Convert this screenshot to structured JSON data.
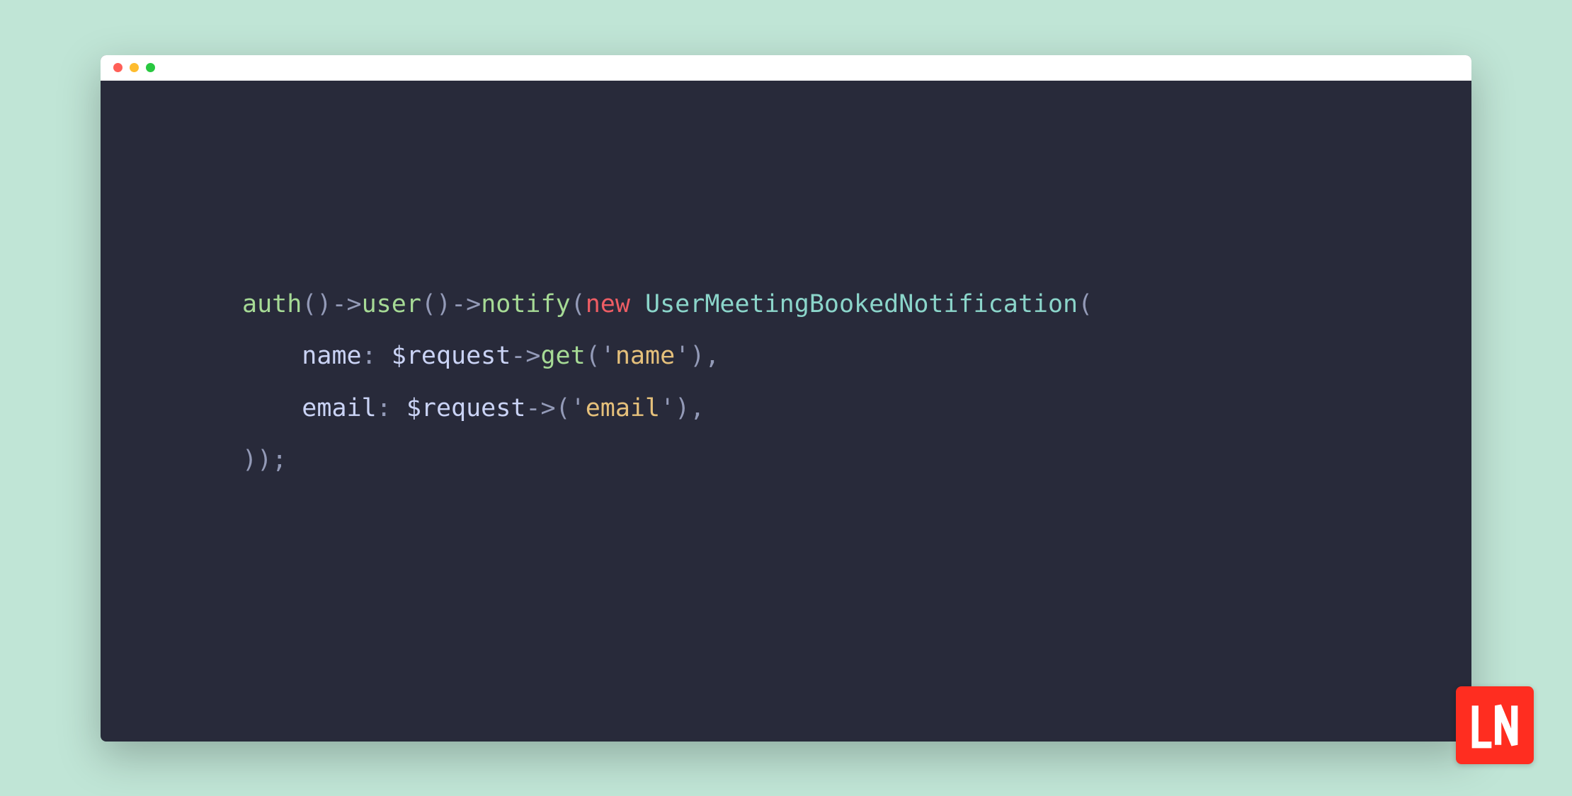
{
  "code": {
    "line1": {
      "auth": "auth",
      "p1": "()",
      "arrow1": "->",
      "user": "user",
      "p2": "()",
      "arrow2": "->",
      "notify": "notify",
      "p3": "(",
      "new": "new",
      "space": " ",
      "class": "UserMeetingBookedNotification",
      "p4": "("
    },
    "line2": {
      "indent": "    ",
      "param": "name",
      "colon": ": ",
      "var": "$request",
      "arrow": "->",
      "method": "get",
      "p1": "(",
      "q1": "'",
      "str": "name",
      "q2": "'",
      "p2": "),"
    },
    "line3": {
      "indent": "    ",
      "param": "email",
      "colon": ": ",
      "var": "$request",
      "arrow": "->",
      "p1": "(",
      "q1": "'",
      "str": "email",
      "q2": "'",
      "p2": "),"
    },
    "line4": {
      "close": "));"
    }
  },
  "logo": {
    "name": "LN"
  }
}
